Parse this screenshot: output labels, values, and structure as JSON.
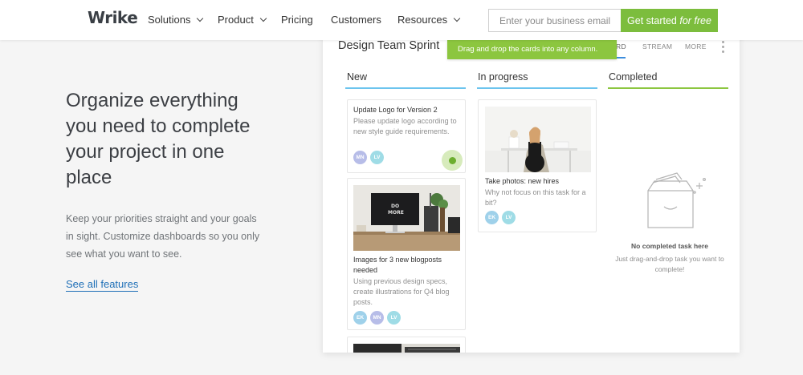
{
  "nav": {
    "logo": "Wrike",
    "items": [
      {
        "label": "Solutions",
        "has_dropdown": true
      },
      {
        "label": "Product",
        "has_dropdown": true
      },
      {
        "label": "Pricing",
        "has_dropdown": false
      },
      {
        "label": "Customers",
        "has_dropdown": false
      },
      {
        "label": "Resources",
        "has_dropdown": true
      }
    ],
    "email_placeholder": "Enter your business email",
    "cta_label": "Get started",
    "cta_emphasis": "for free"
  },
  "hero": {
    "title": "Organize everything you need to complete your project in one place",
    "subtitle": "Keep your priorities straight and your goals in sight. Customize dashboards so you only see what you want to see.",
    "link": "See all features"
  },
  "board": {
    "title": "Design Team Sprint",
    "tooltip": "Drag and drop the cards into any column.",
    "tabs": [
      "RD",
      "STREAM",
      "MORE"
    ],
    "columns": [
      {
        "name": "New",
        "cards": [
          {
            "title": "Update Logo for Version 2",
            "desc": "Please update logo according to new style guide requirements.",
            "avatars": [
              "MN",
              "LV"
            ]
          },
          {
            "title": "Images for 3 new blogposts needed",
            "desc": "Using previous design specs, create illustrations for Q4 blog posts.",
            "avatars": [
              "EK",
              "MN",
              "LV"
            ],
            "image_text": "DO MORE"
          }
        ]
      },
      {
        "name": "In progress",
        "cards": [
          {
            "title": "Take photos: new hires",
            "desc": "Why not focus on this task for a bit?",
            "avatars": [
              "EK",
              "LV"
            ]
          }
        ]
      },
      {
        "name": "Completed",
        "cards": [],
        "empty_title": "No completed task here",
        "empty_desc": "Just drag-and-drop task you want to complete!"
      }
    ]
  },
  "colors": {
    "brand_green": "#7cbd3d",
    "link_blue": "#1e6fb7",
    "col_new": "#6cc4ee",
    "col_in_progress": "#6cc4ee",
    "col_completed": "#8cc63f"
  }
}
